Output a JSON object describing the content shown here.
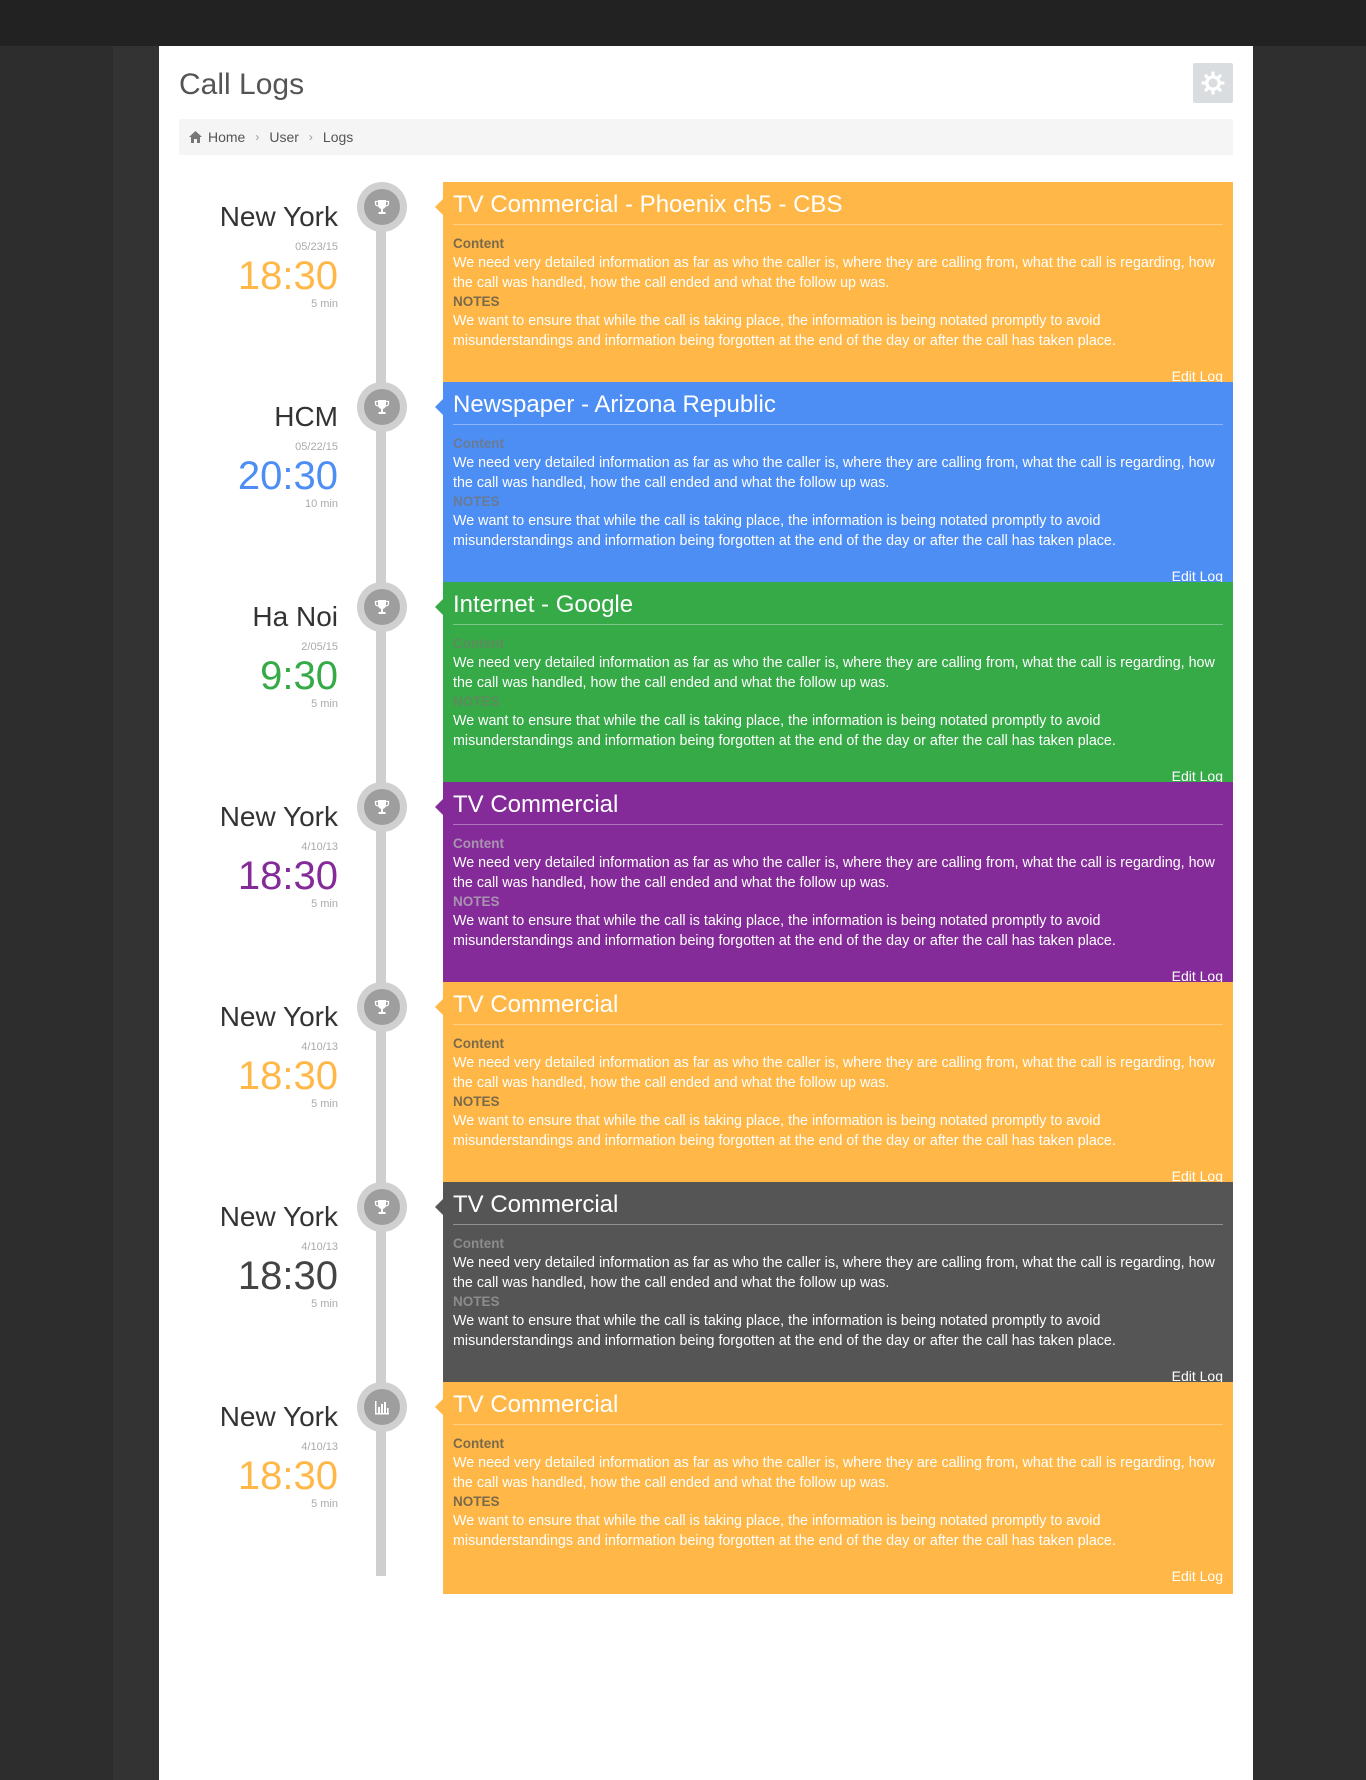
{
  "page": {
    "title": "Call Logs",
    "settings_icon": "gear-icon"
  },
  "breadcrumb": [
    {
      "label": "Home",
      "icon": "home-icon"
    },
    {
      "label": "User"
    },
    {
      "label": "Logs"
    }
  ],
  "entries": [
    {
      "city": "New York",
      "date": "05/23/15",
      "time": "18:30",
      "duration": "5 min",
      "icon": "trophy-icon",
      "title": "TV Commercial - Phoenix ch5 - CBS",
      "content_label": "Content",
      "content_text": "We need very detailed information as far as who the caller is, where they are calling from, what the call is regarding, how the call was handled, how the call ended and what the follow up was.",
      "notes_label": "NOTES",
      "notes_text": "We want to ensure that while the call is taking place, the information is being notated promptly to avoid misunderstandings and information being forgotten at the end of the day or after the call has taken place.",
      "edit_label": "Edit Log",
      "color": "#ffb848",
      "label_color": "#7b6a4a"
    },
    {
      "city": "HCM",
      "date": "05/22/15",
      "time": "20:30",
      "duration": "10 min",
      "icon": "trophy-icon",
      "title": "Newspaper - Arizona Republic",
      "content_label": "Content",
      "content_text": "We need very detailed information as far as who the caller is, where they are calling from, what the call is regarding, how the call was handled, how the call ended and what the follow up was.",
      "notes_label": "NOTES",
      "notes_text": "We want to ensure that while the call is taking place, the information is being notated promptly to avoid misunderstandings and information being forgotten at the end of the day or after the call has taken place.",
      "edit_label": "Edit Log",
      "color": "#4d8ef5",
      "label_color": "#6a7a92"
    },
    {
      "city": "Ha Noi",
      "date": "2/05/15",
      "time": "9:30",
      "duration": "5 min",
      "icon": "trophy-icon",
      "title": "Internet - Google",
      "content_label": "Content",
      "content_text": "We need very detailed information as far as who the caller is, where they are calling from, what the call is regarding, how the call was handled, how the call ended and what the follow up was.",
      "notes_label": "NOTES",
      "notes_text": "We want to ensure that while the call is taking place, the information is being notated promptly to avoid misunderstandings and information being forgotten at the end of the day or after the call has taken place.",
      "edit_label": "Edit Log",
      "color": "#35aa47",
      "label_color": "#5e8a5e"
    },
    {
      "city": "New York",
      "date": "4/10/13",
      "time": "18:30",
      "duration": "5 min",
      "icon": "trophy-icon",
      "title": "TV Commercial",
      "content_label": "Content",
      "content_text": "We need very detailed information as far as who the caller is, where they are calling from, what the call is regarding, how the call was handled, how the call ended and what the follow up was.",
      "notes_label": "NOTES",
      "notes_text": "We want to ensure that while the call is taking place, the information is being notated promptly to avoid misunderstandings and information being forgotten at the end of the day or after the call has taken place.",
      "edit_label": "Edit Log",
      "color": "#852b99",
      "label_color": "#a993b0"
    },
    {
      "city": "New York",
      "date": "4/10/13",
      "time": "18:30",
      "duration": "5 min",
      "icon": "trophy-icon",
      "title": "TV Commercial",
      "content_label": "Content",
      "content_text": "We need very detailed information as far as who the caller is, where they are calling from, what the call is regarding, how the call was handled, how the call ended and what the follow up was.",
      "notes_label": "NOTES",
      "notes_text": "We want to ensure that while the call is taking place, the information is being notated promptly to avoid misunderstandings and information being forgotten at the end of the day or after the call has taken place.",
      "edit_label": "Edit Log",
      "color": "#ffb848",
      "label_color": "#7b6a4a"
    },
    {
      "city": "New York",
      "date": "4/10/13",
      "time": "18:30",
      "duration": "5 min",
      "icon": "trophy-icon",
      "title": "TV Commercial",
      "content_label": "Content",
      "content_text": "We need very detailed information as far as who the caller is, where they are calling from, what the call is regarding, how the call was handled, how the call ended and what the follow up was.",
      "notes_label": "NOTES",
      "notes_text": "We want to ensure that while the call is taking place, the information is being notated promptly to avoid misunderstandings and information being forgotten at the end of the day or after the call has taken place.",
      "edit_label": "Edit Log",
      "color": "#555555",
      "label_color": "#8c8c8c"
    },
    {
      "city": "New York",
      "date": "4/10/13",
      "time": "18:30",
      "duration": "5 min",
      "icon": "bar-chart-icon",
      "title": "TV Commercial",
      "content_label": "Content",
      "content_text": "We need very detailed information as far as who the caller is, where they are calling from, what the call is regarding, how the call was handled, how the call ended and what the follow up was.",
      "notes_label": "NOTES",
      "notes_text": "We want to ensure that while the call is taking place, the information is being notated promptly to avoid misunderstandings and information being forgotten at the end of the day or after the call has taken place.",
      "edit_label": "Edit Log",
      "color": "#ffb848",
      "label_color": "#7b6a4a"
    }
  ]
}
